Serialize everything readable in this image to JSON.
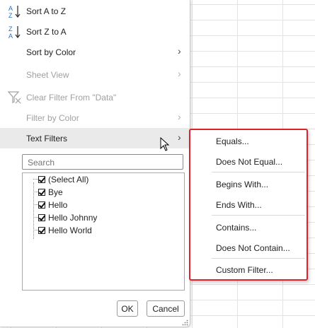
{
  "menu": {
    "sort_az": "Sort A to Z",
    "sort_za": "Sort Z to A",
    "sort_by_color": "Sort by Color",
    "sheet_view": "Sheet View",
    "clear_filter": "Clear Filter From \"Data\"",
    "filter_by_color": "Filter by Color",
    "text_filters": "Text Filters"
  },
  "search": {
    "placeholder": "Search"
  },
  "list": {
    "items": [
      {
        "label": "(Select All)",
        "checked": true
      },
      {
        "label": "Bye",
        "checked": true
      },
      {
        "label": "Hello",
        "checked": true
      },
      {
        "label": "Hello Johnny",
        "checked": true
      },
      {
        "label": "Hello World",
        "checked": true
      }
    ]
  },
  "buttons": {
    "ok": "OK",
    "cancel": "Cancel"
  },
  "submenu": {
    "equals": "Equals...",
    "does_not_equal": "Does Not Equal...",
    "begins_with": "Begins With...",
    "ends_with": "Ends With...",
    "contains": "Contains...",
    "does_not_contain": "Does Not Contain...",
    "custom_filter": "Custom Filter..."
  },
  "colors": {
    "highlight_border": "#e0202a",
    "az_blue": "#1f6fc5"
  }
}
